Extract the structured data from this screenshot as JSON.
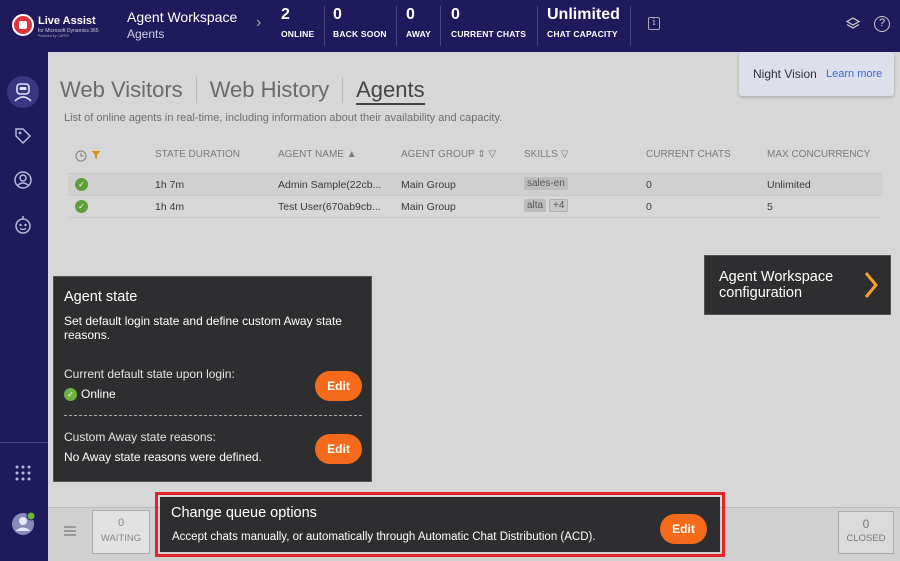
{
  "header": {
    "logo_text": "Live Assist",
    "logo_subtext": "for Microsoft Dynamics 365",
    "logo_powered": "Powered by CAFEX",
    "title": "Agent Workspace",
    "subtitle": "Agents",
    "stats": [
      {
        "value": "2",
        "label": "ONLINE"
      },
      {
        "value": "0",
        "label": "BACK SOON"
      },
      {
        "value": "0",
        "label": "AWAY"
      },
      {
        "value": "0",
        "label": "CURRENT CHATS"
      },
      {
        "value": "Unlimited",
        "label": "CHAT CAPACITY"
      }
    ]
  },
  "night_vision": {
    "label": "Night Vision",
    "link": "Learn more"
  },
  "tabs": [
    {
      "label": "Web Visitors"
    },
    {
      "label": "Web History"
    },
    {
      "label": "Agents"
    }
  ],
  "description": "List of online agents in real-time, including information about their availability and capacity.",
  "table": {
    "columns": [
      "STATE DURATION",
      "AGENT NAME",
      "AGENT GROUP",
      "SKILLS",
      "CURRENT CHATS",
      "MAX CONCURRENCY"
    ],
    "rows": [
      {
        "state_duration": "1h 7m",
        "agent_name": "Admin Sample(22cb...",
        "agent_group": "Main Group",
        "skill": "sales-en",
        "skill_more": "",
        "current_chats": "0",
        "max_concurrency": "Unlimited"
      },
      {
        "state_duration": "1h 4m",
        "agent_name": "Test User(670ab9cb...",
        "agent_group": "Main Group",
        "skill": "alta",
        "skill_more": "+4",
        "current_chats": "0",
        "max_concurrency": "5"
      }
    ]
  },
  "agent_state_panel": {
    "title": "Agent state",
    "description": "Set default login state and define custom Away state reasons.",
    "default_label": "Current default state upon login:",
    "default_value": "Online",
    "away_label": "Custom Away state reasons:",
    "away_value": "No Away state reasons were defined.",
    "edit_label": "Edit"
  },
  "workspace_config": {
    "label": "Agent Workspace configuration"
  },
  "queue_panel": {
    "title": "Change queue options",
    "description": "Accept chats manually, or automatically through Automatic Chat Distribution (ACD).",
    "edit_label": "Edit"
  },
  "bottom": {
    "waiting": {
      "value": "0",
      "label": "WAITING"
    },
    "closed": {
      "value": "0",
      "label": "CLOSED"
    }
  },
  "colors": {
    "header_bg": "#1e1a5c",
    "accent_orange": "#f36b1a",
    "online_green": "#6cb33f",
    "highlight_red": "#e0242a"
  }
}
